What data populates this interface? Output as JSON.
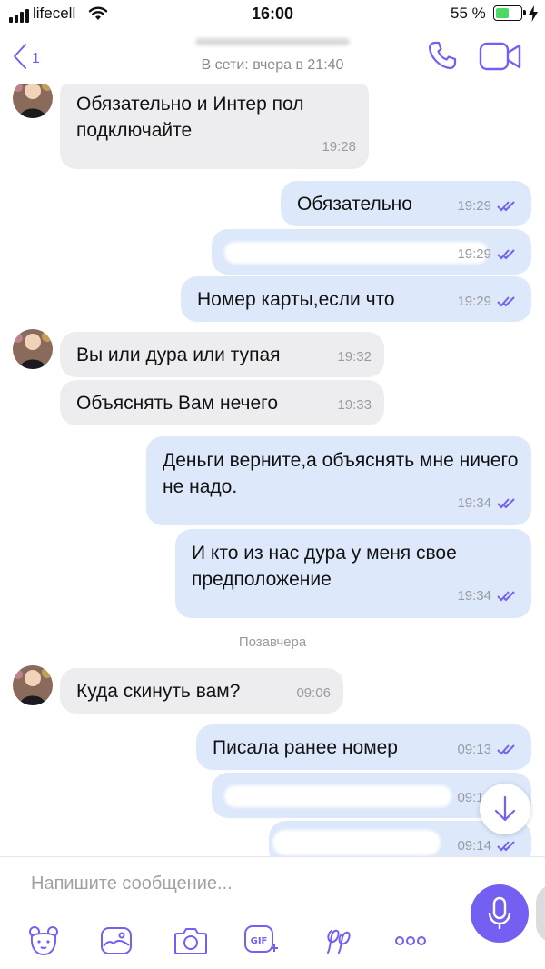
{
  "status_bar": {
    "carrier": "lifecell",
    "time": "16:00",
    "battery_percent": "55 %",
    "battery_level": 0.55
  },
  "header": {
    "back_count": "1",
    "contact_name": "",
    "last_seen": "В сети: вчера в 21:40",
    "icons": [
      "back-chevron-icon",
      "phone-icon",
      "video-camera-icon"
    ]
  },
  "messages": [
    {
      "dir": "in",
      "text": "Обязательно и Интер пол подключайте",
      "time": "19:28"
    },
    {
      "dir": "out",
      "text": "Обязательно",
      "time": "19:29"
    },
    {
      "dir": "out",
      "text": "",
      "time": "19:29",
      "redacted": true
    },
    {
      "dir": "out",
      "text": "Номер карты,если что",
      "time": "19:29"
    },
    {
      "dir": "in",
      "text": "Вы или дура или тупая",
      "time": "19:32"
    },
    {
      "dir": "in",
      "text": "Объяснять Вам нечего",
      "time": "19:33"
    },
    {
      "dir": "out",
      "text": "Деньги верните,а объяснять мне ничего не надо.",
      "time": "19:34"
    },
    {
      "dir": "out",
      "text": "И кто из нас дура у меня свое предположение",
      "time": "19:34"
    },
    {
      "dir": "in",
      "text": "Куда скинуть вам?",
      "time": "09:06"
    },
    {
      "dir": "out",
      "text": "Писала ранее номер",
      "time": "09:13"
    },
    {
      "dir": "out",
      "text": "",
      "time": "09:14",
      "redacted": true
    },
    {
      "dir": "out",
      "text": "",
      "time": "09:14",
      "redacted": true
    }
  ],
  "date_separator": "Позавчера",
  "composer": {
    "placeholder": "Напишите сообщение...",
    "tools": [
      "sticker-icon",
      "gallery-icon",
      "camera-icon",
      "gif-icon",
      "doodle-icon",
      "more-icon"
    ]
  },
  "colors": {
    "accent": "#7360f2",
    "incoming_bubble": "#ededef",
    "outgoing_bubble": "#dde9fb",
    "read_check": "#7360f2"
  }
}
